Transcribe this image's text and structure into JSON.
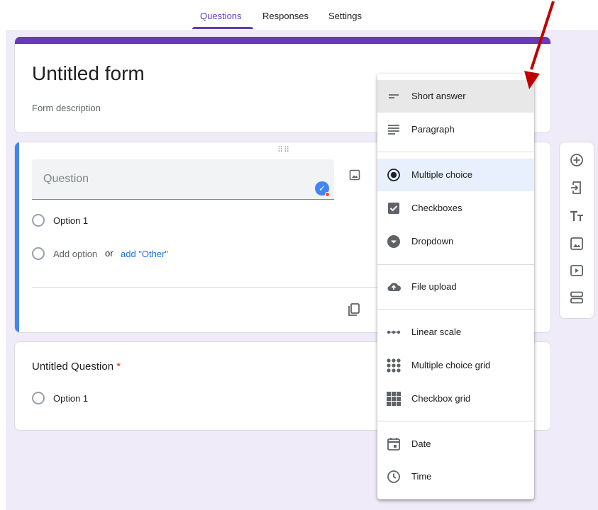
{
  "tabs": [
    {
      "label": "Questions",
      "active": true
    },
    {
      "label": "Responses",
      "active": false
    },
    {
      "label": "Settings",
      "active": false
    }
  ],
  "form": {
    "title": "Untitled form",
    "description_placeholder": "Form description"
  },
  "question_editor": {
    "placeholder": "Question",
    "options": [
      "Option 1"
    ],
    "add_option": "Add option",
    "or_text": "or",
    "add_other": "add \"Other\""
  },
  "question2": {
    "title": "Untitled Question",
    "required_mark": "*",
    "options": [
      "Option 1"
    ]
  },
  "type_menu": {
    "items": [
      {
        "label": "Short answer",
        "icon": "short-answer-icon",
        "state": "hover"
      },
      {
        "label": "Paragraph",
        "icon": "paragraph-icon"
      },
      {
        "label": "Multiple choice",
        "icon": "radio-checked-icon",
        "state": "selected"
      },
      {
        "label": "Checkboxes",
        "icon": "checkbox-icon"
      },
      {
        "label": "Dropdown",
        "icon": "dropdown-icon"
      },
      {
        "label": "File upload",
        "icon": "cloud-upload-icon"
      },
      {
        "label": "Linear scale",
        "icon": "linear-scale-icon"
      },
      {
        "label": "Multiple choice grid",
        "icon": "dot-grid-icon"
      },
      {
        "label": "Checkbox grid",
        "icon": "checkbox-grid-icon"
      },
      {
        "label": "Date",
        "icon": "calendar-icon"
      },
      {
        "label": "Time",
        "icon": "clock-icon"
      }
    ]
  },
  "toolbar": [
    "add-question-icon",
    "import-questions-icon",
    "add-title-icon",
    "add-image-icon",
    "add-video-icon",
    "add-section-icon"
  ],
  "colors": {
    "accent": "#673ab7",
    "active_question": "#4285f4",
    "arrow": "#c00000",
    "link": "#1a73e8",
    "required": "#d93025"
  }
}
